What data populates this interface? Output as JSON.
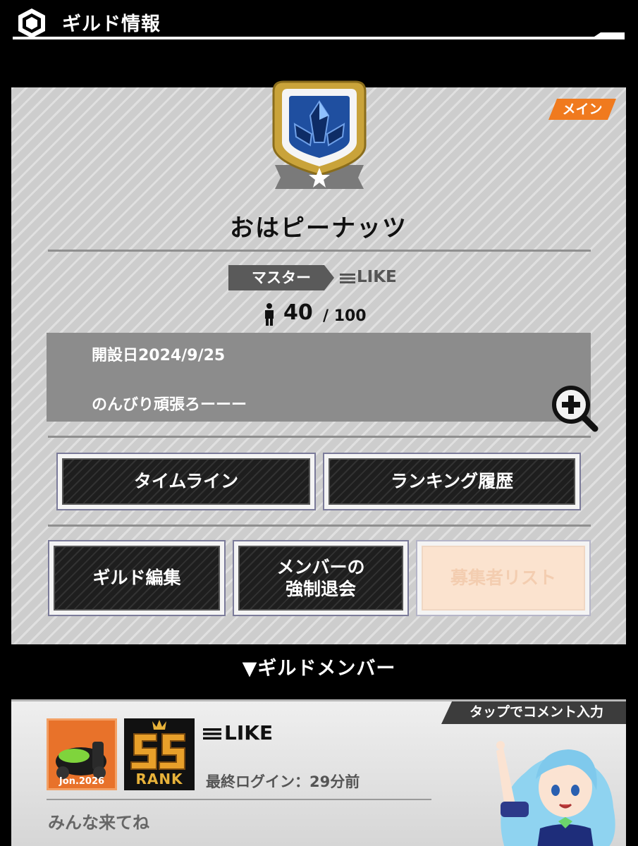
{
  "header": {
    "title": "ギルド情報"
  },
  "guild": {
    "tag": "メイン",
    "name": "おはピーナッツ",
    "master_label": "マスター",
    "master_name": "LIKE",
    "member_count": "40",
    "member_max": "/ 100",
    "founded": "開設日2024/9/25",
    "description": "のんびり頑張ろーーー"
  },
  "buttons": {
    "timeline": "タイムライン",
    "ranking_history": "ランキング履歴",
    "edit_guild": "ギルド編集",
    "kick_member_line1": "メンバーの",
    "kick_member_line2": "強制退会",
    "applicant_list": "募集者リスト"
  },
  "members_section": {
    "title": "▼ギルドメンバー"
  },
  "member_card": {
    "tag": "タップでコメント入力",
    "avatar_date": "Jon.2026",
    "rank": "RANK",
    "name": "LIKE",
    "last_login": "最終ログイン：29分前",
    "comment": "みんな来てね"
  },
  "colors": {
    "accent_orange": "#f07a1e",
    "emblem_gold": "#c9a33a",
    "emblem_blue": "#1f4fa0",
    "panel_gray": "#cdcdcd"
  },
  "icons": [
    "hexagon-icon",
    "emblem-icon",
    "triple-bar-icon",
    "person-icon",
    "zoom-in-icon"
  ]
}
